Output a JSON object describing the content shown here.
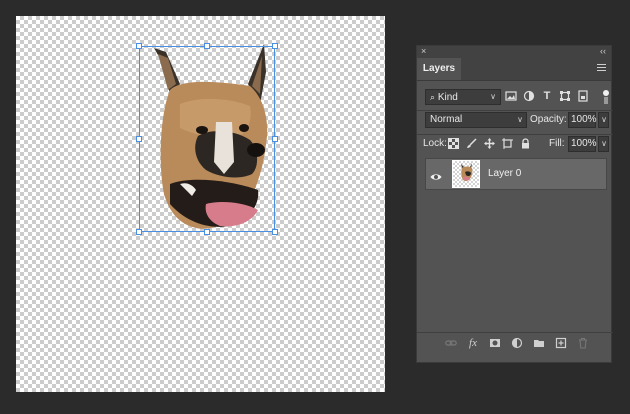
{
  "panel": {
    "close_glyph": "×",
    "collapse_glyph": "‹‹",
    "tab_label": "Layers",
    "filter": {
      "kind_label": "Kind",
      "icons": [
        "image-filter-icon",
        "adjustment-filter-icon",
        "type-filter-icon",
        "shape-filter-icon",
        "smart-object-filter-icon"
      ]
    },
    "blend_mode": "Normal",
    "opacity_label": "Opacity:",
    "opacity_value": "100%",
    "lock_label": "Lock:",
    "lock_icons": [
      "lock-transparent-pixels-icon",
      "lock-image-pixels-icon",
      "lock-position-icon",
      "lock-artboard-icon",
      "lock-all-icon"
    ],
    "fill_label": "Fill:",
    "fill_value": "100%",
    "layers": [
      {
        "name": "Layer 0",
        "visible": true
      }
    ],
    "bottom_icons": [
      "link-layers-icon",
      "fx-icon",
      "add-mask-icon",
      "adjustment-layer-icon",
      "new-group-icon",
      "new-layer-icon",
      "delete-layer-icon"
    ],
    "fx_glyph": "fx"
  },
  "colors": {
    "background": "#2b2b2b",
    "panel": "#535353",
    "selection": "#4a90e2",
    "selected_layer": "#686868"
  }
}
